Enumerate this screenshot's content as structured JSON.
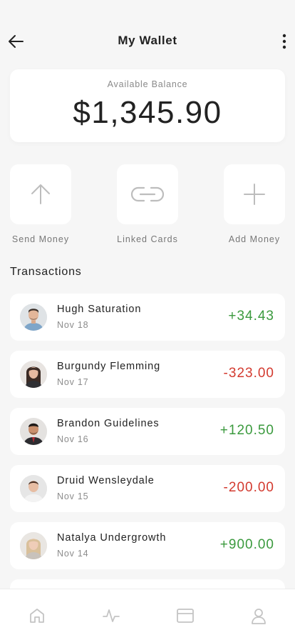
{
  "header": {
    "title": "My Wallet",
    "back_icon": "arrow-left-icon",
    "more_icon": "more-vertical-icon"
  },
  "balance": {
    "label": "Available Balance",
    "amount": "$1,345.90"
  },
  "actions": [
    {
      "label": "Send Money",
      "icon": "arrow-up-icon"
    },
    {
      "label": "Linked Cards",
      "icon": "link-icon"
    },
    {
      "label": "Add Money",
      "icon": "plus-icon"
    }
  ],
  "transactions_title": "Transactions",
  "transactions": [
    {
      "name": "Hugh Saturation",
      "date": "Nov 18",
      "amount": "+34.43"
    },
    {
      "name": "Burgundy Flemming",
      "date": "Nov 17",
      "amount": "-323.00"
    },
    {
      "name": "Brandon Guidelines",
      "date": "Nov 16",
      "amount": "+120.50"
    },
    {
      "name": "Druid Wensleydale",
      "date": "Nov 15",
      "amount": "-200.00"
    },
    {
      "name": "Natalya Undergrowth",
      "date": "Nov 14",
      "amount": "+900.00"
    }
  ],
  "bottom_nav": [
    "home-icon",
    "activity-icon",
    "card-icon",
    "profile-icon"
  ],
  "colors": {
    "positive": "#3b9a3e",
    "negative": "#d33a2f",
    "background": "#f6f6f6"
  }
}
